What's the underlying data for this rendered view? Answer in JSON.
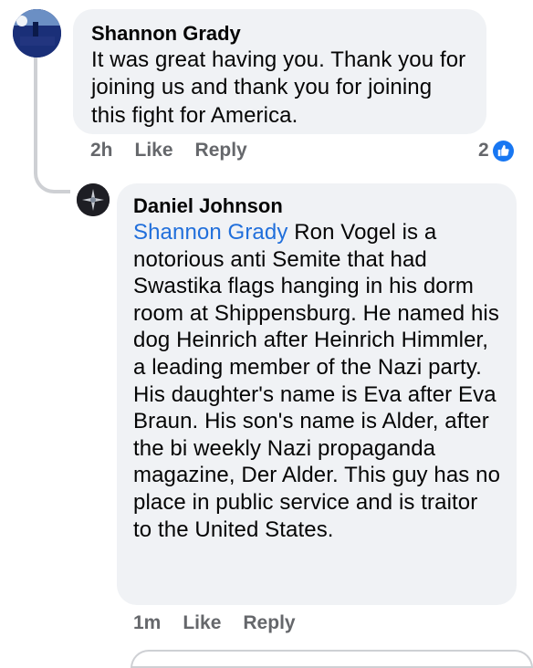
{
  "comments": [
    {
      "author": "Shannon Grady",
      "text": "It was great having you. Thank you for joining us and thank you for joining this fight for America.",
      "time": "2h",
      "like_label": "Like",
      "reply_label": "Reply",
      "reaction_count": "2",
      "avatar_text": "MOMS FOR LIBERTY"
    },
    {
      "author": "Daniel Johnson",
      "mention": "Shannon Grady",
      "text": " Ron Vogel is a notorious anti Semite that had Swastika flags hanging in his dorm room at Shippensburg. He named his dog Heinrich after Heinrich Himmler, a leading member of the Nazi party. His daughter's name is Eva after Eva Braun. His son's name is Alder, after the bi weekly Nazi propaganda magazine, Der Alder. This guy has no place in public service and is traitor to the United States.",
      "time": "1m",
      "like_label": "Like",
      "reply_label": "Reply"
    }
  ],
  "colors": {
    "bubble": "#f0f2f5",
    "mention": "#216fdb",
    "meta": "#65676b",
    "like_blue": "#1877f2"
  }
}
